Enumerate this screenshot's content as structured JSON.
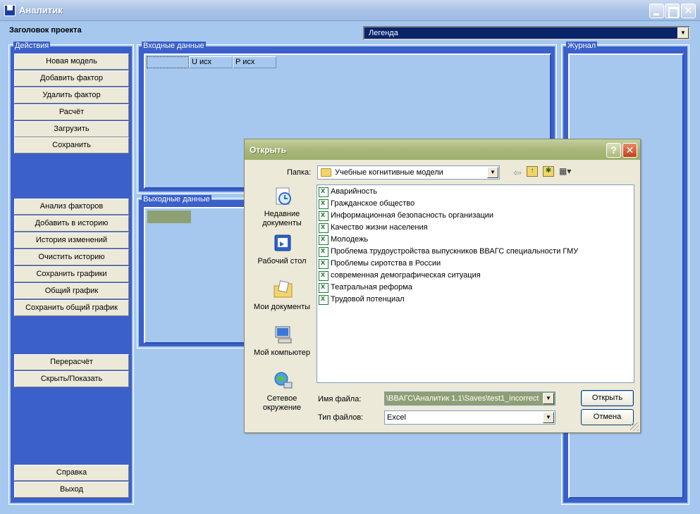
{
  "window": {
    "title": "Аналитик",
    "app_icon_glyph": "▀"
  },
  "header": {
    "project_title": "Заголовок проекта",
    "legend_value": "Легенда"
  },
  "actions": {
    "label": "Действия",
    "buttons_top": [
      "Новая модель",
      "Добавить фактор",
      "Удалить фактор",
      "Расчёт",
      "Загрузить",
      "Сохранить"
    ],
    "buttons_mid": [
      "Анализ факторов",
      "Добавить в историю",
      "История изменений",
      "Очистить историю",
      "Сохранить графики",
      "Общий график",
      "Сохранить общий график"
    ],
    "buttons_lower": [
      "Перерасчёт",
      "Скрыть/Показать"
    ],
    "buttons_bottom": [
      "Справка",
      "Выход"
    ]
  },
  "input": {
    "label": "Входные данные",
    "columns": [
      "",
      "U исх",
      "P исх"
    ]
  },
  "output": {
    "label": "Выходные данные"
  },
  "journal": {
    "label": "Журнал"
  },
  "dialog": {
    "title": "Открыть",
    "help_glyph": "?",
    "close_glyph": "✕",
    "folder_label": "Папка:",
    "folder_value": "Учебные когнитивные модели",
    "places": [
      "Недавние документы",
      "Рабочий стол",
      "Мои документы",
      "Мой компьютер",
      "Сетевое окружение"
    ],
    "files": [
      "Аварийность",
      "Гражданское общество",
      "Информационная безопасность организации",
      "Качество жизни населения",
      "Молодежь",
      "Проблема трудоустройства выпускников ВВАГС специальности ГМУ",
      "Проблемы сиротства в России",
      "современная демографическая ситуация",
      "Театральная реформа",
      "Трудовой потенциал"
    ],
    "filename_label": "Имя файла:",
    "filename_value": "\\ВВАГС\\Аналитик 1.1\\Saves\\test1_incorrect",
    "filetype_label": "Тип файлов:",
    "filetype_value": "Excel",
    "open_label": "Открыть",
    "cancel_label": "Отмена"
  },
  "colors": {
    "accent": "#3b60c9",
    "background": "#a6c8ee",
    "selection": "#0a246a"
  }
}
